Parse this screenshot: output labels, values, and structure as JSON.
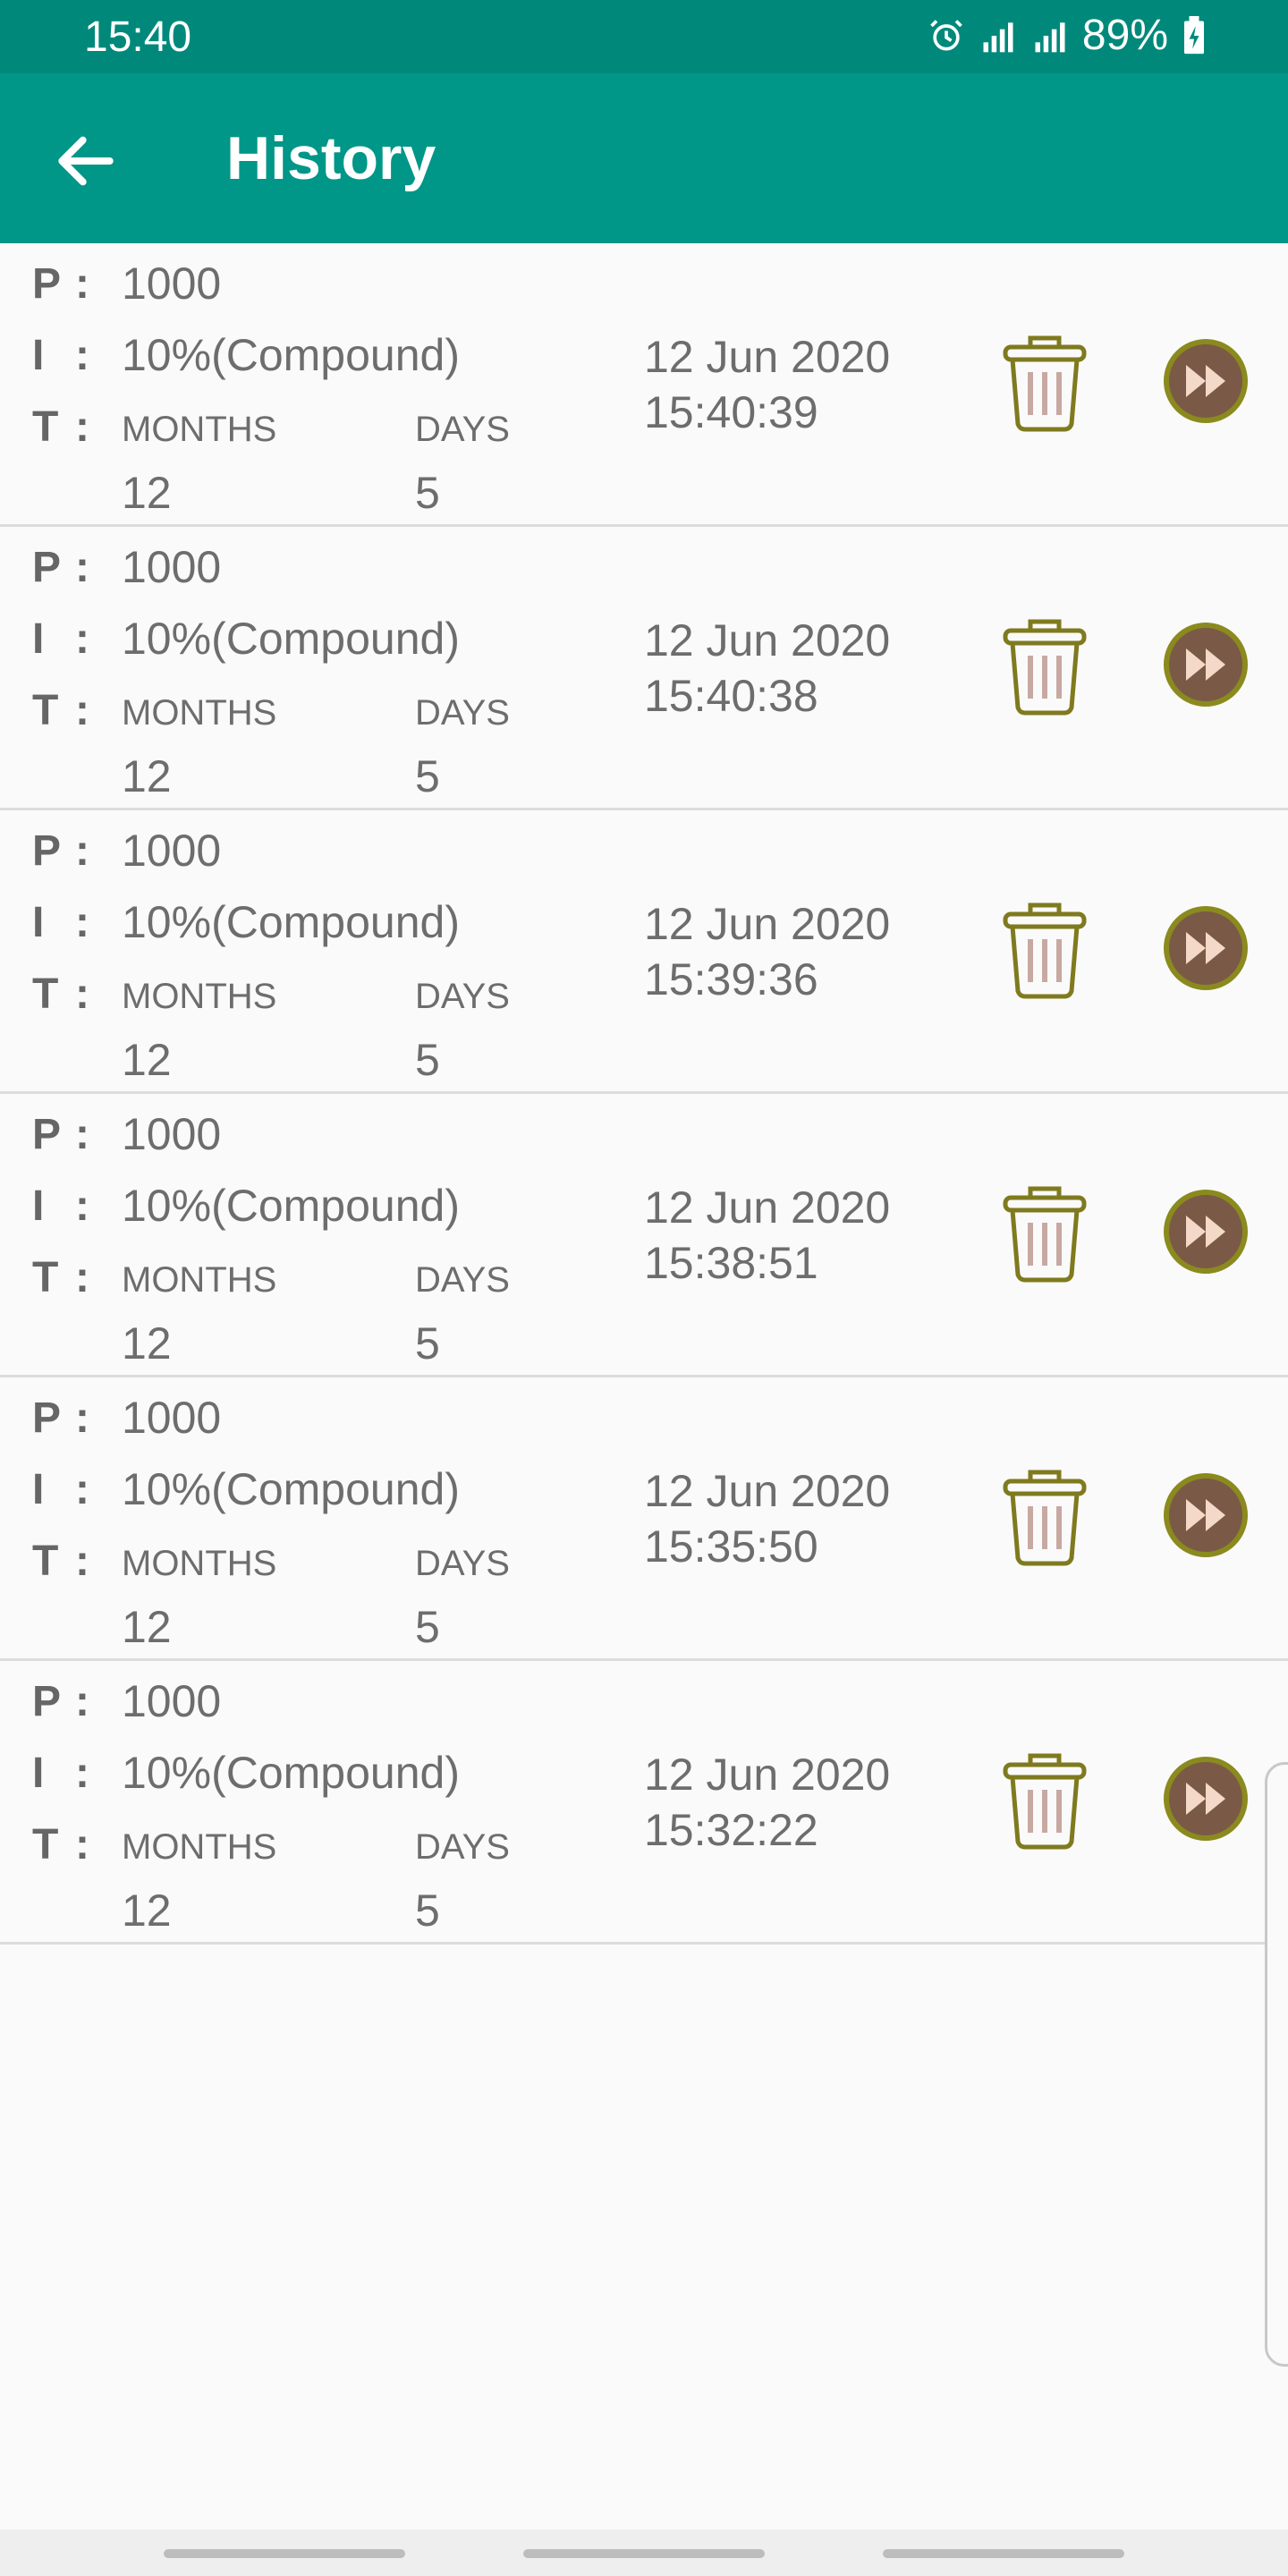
{
  "status": {
    "time": "15:40",
    "battery": "89%"
  },
  "appbar": {
    "title": "History"
  },
  "labels": {
    "p": "P",
    "i": "I",
    "t": "T",
    "colon": ":",
    "months": "MONTHS",
    "days": "DAYS"
  },
  "items": [
    {
      "principal": "1000",
      "interest": "10%(Compound)",
      "months": "12",
      "days": "5",
      "date": "12 Jun 2020",
      "time": "15:40:39"
    },
    {
      "principal": "1000",
      "interest": "10%(Compound)",
      "months": "12",
      "days": "5",
      "date": "12 Jun 2020",
      "time": "15:40:38"
    },
    {
      "principal": "1000",
      "interest": "10%(Compound)",
      "months": "12",
      "days": "5",
      "date": "12 Jun 2020",
      "time": "15:39:36"
    },
    {
      "principal": "1000",
      "interest": "10%(Compound)",
      "months": "12",
      "days": "5",
      "date": "12 Jun 2020",
      "time": "15:38:51"
    },
    {
      "principal": "1000",
      "interest": "10%(Compound)",
      "months": "12",
      "days": "5",
      "date": "12 Jun 2020",
      "time": "15:35:50"
    },
    {
      "principal": "1000",
      "interest": "10%(Compound)",
      "months": "12",
      "days": "5",
      "date": "12 Jun 2020",
      "time": "15:32:22"
    }
  ],
  "icons": {
    "back": "arrow-left-icon",
    "delete": "trash-icon",
    "open": "fast-forward-icon"
  },
  "colors": {
    "primary": "#009688",
    "primary_dark": "#00897b",
    "trash": "#7f7a1e",
    "play_fill": "#7a5a46",
    "play_ring": "#8a8a1e"
  }
}
